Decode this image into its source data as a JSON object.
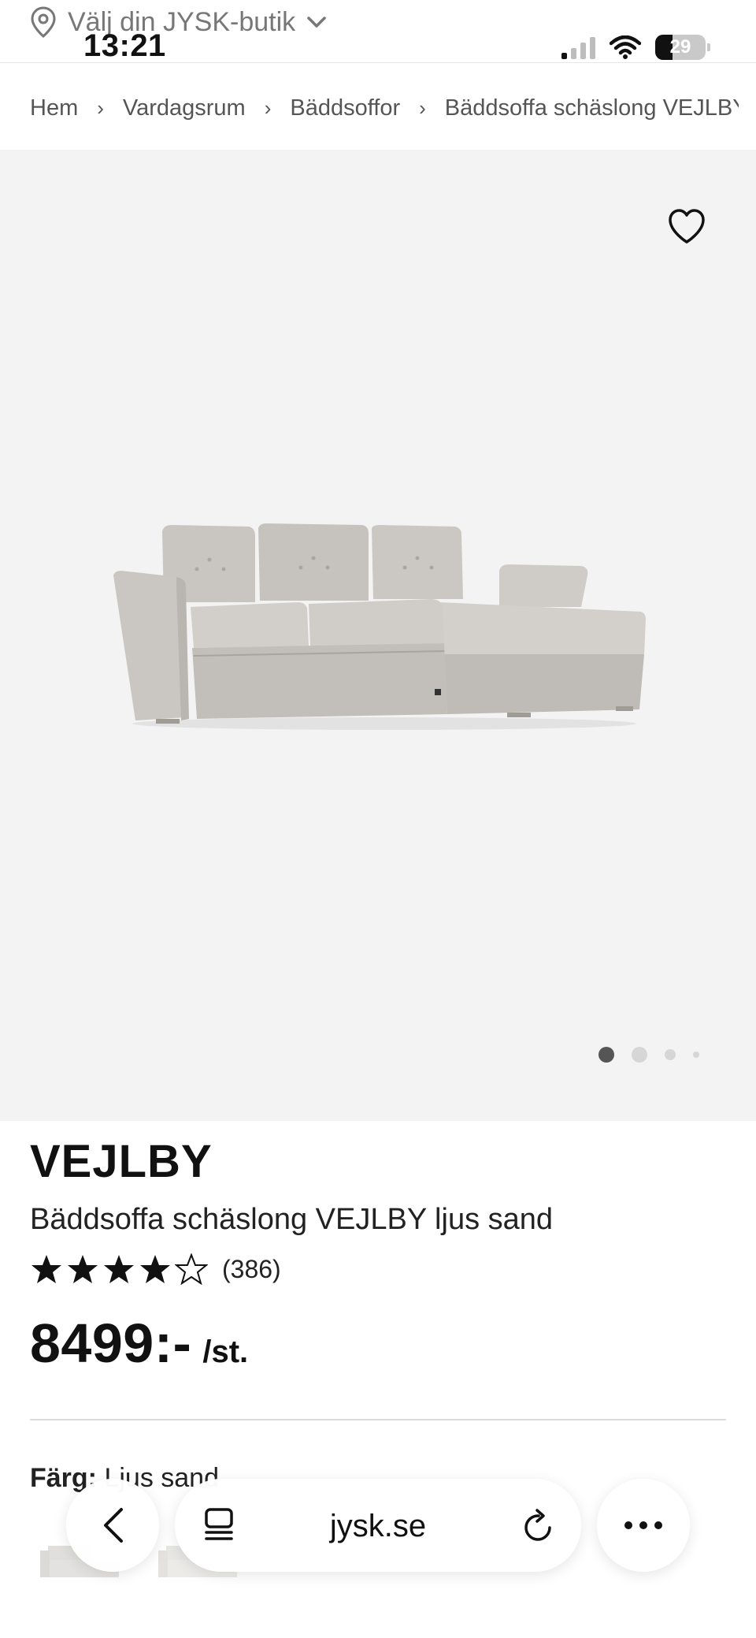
{
  "header": {
    "store_label": "Välj din JYSK-butik",
    "time": "13:21",
    "battery": "29"
  },
  "breadcrumb": {
    "items": [
      "Hem",
      "Vardagsrum",
      "Bäddsoffor",
      "Bäddsoffa schäslong VEJLBY ljus sand"
    ],
    "separator": "›"
  },
  "gallery": {
    "image_name": "sofa-image",
    "dots_count": 4,
    "active_dot": 0
  },
  "product": {
    "brand": "VEJLBY",
    "name": "Bäddsoffa schäslong VEJLBY ljus sand",
    "rating": 4,
    "rating_max": 5,
    "review_count": "(386)",
    "price": "8499:-",
    "unit": "/st.",
    "color_label": "Färg:",
    "color_value": "Ljus sand"
  },
  "browser": {
    "url": "jysk.se"
  },
  "icons": {
    "location": "location-pin-icon",
    "chevron": "chevron-down-icon",
    "heart": "heart-icon",
    "back": "back-arrow-icon",
    "tabs": "tabs-icon",
    "reload": "reload-icon",
    "more": "more-icon"
  },
  "colors": {
    "gallery_bg": "#f3f3f3",
    "text": "#111111",
    "muted": "#777777"
  }
}
